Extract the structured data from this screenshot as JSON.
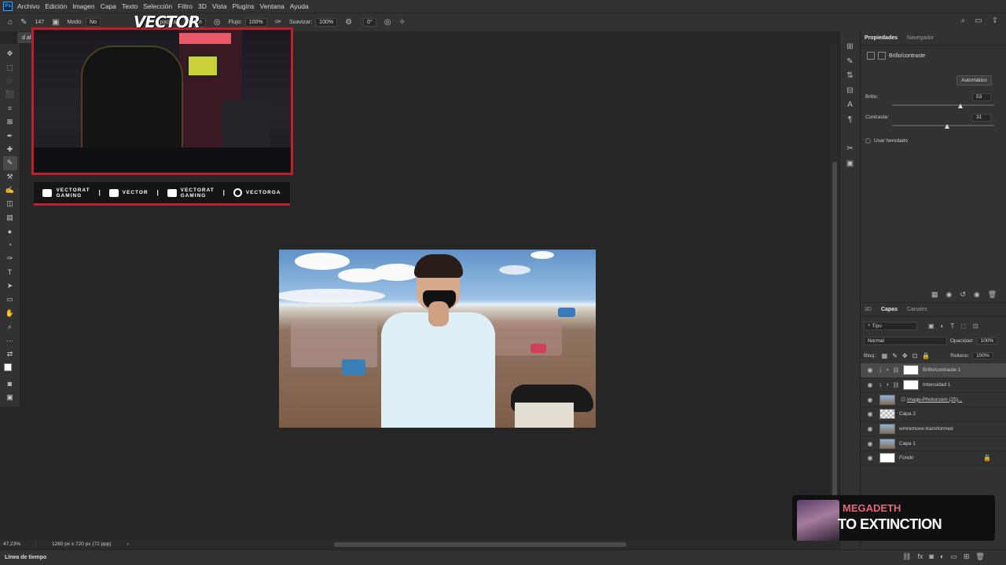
{
  "menubar": {
    "logo": "Ps",
    "items": [
      "Archivo",
      "Edición",
      "Imagen",
      "Capa",
      "Texto",
      "Selección",
      "Filtro",
      "3D",
      "Vista",
      "Plugins",
      "Ventana",
      "Ayuda"
    ]
  },
  "options": {
    "mode_label": "Modo:",
    "mode_value": "No",
    "opacity_label": "Opacidad:",
    "opacity_value": "100%",
    "flow_label": "Flujo:",
    "flow_value": "100%",
    "smooth_label": "Suavizar:",
    "smooth_value": "100%",
    "angle_value": "0°",
    "brush_size": "147"
  },
  "overlay_logo": "VECTOR",
  "doc_tab": "d al",
  "social": [
    {
      "icon": "youtube-icon",
      "text": "VECTORAT\nGAMING"
    },
    {
      "icon": "twitch-icon",
      "text": "VECTOR"
    },
    {
      "icon": "twitter-icon",
      "text": "VECTORAT\nGAMING"
    },
    {
      "icon": "instagram-icon",
      "text": "VECTORGA"
    }
  ],
  "properties": {
    "tab_properties": "Propiedades",
    "tab_navigator": "Navegador",
    "adjustment_name": "Brillo/contraste",
    "auto_button": "Automático",
    "brightness_label": "Brillo:",
    "brightness_value": "53",
    "contrast_label": "Contraste:",
    "contrast_value": "31",
    "legacy_label": "Usar heredado"
  },
  "layers_panel": {
    "tab_3d": "3D",
    "tab_layers": "Capas",
    "tab_channels": "Canales",
    "filter_label": "Tipo",
    "blend_mode": "Normal",
    "opacity_label": "Opacidad:",
    "opacity_value": "100%",
    "lock_label": "Bloq.:",
    "fill_label": "Relleno:",
    "fill_value": "100%",
    "layers": [
      {
        "name": "Brillo/contraste 1",
        "thumb": "white",
        "adjust": true,
        "selected": true
      },
      {
        "name": "Intensidad 1",
        "thumb": "white",
        "adjust": true,
        "selected": false
      },
      {
        "name": "image-Photoroom (25)...",
        "thumb": "img",
        "adjust": false,
        "selected": false
      },
      {
        "name": "Capa 2",
        "thumb": "checker",
        "adjust": false,
        "selected": false
      },
      {
        "name": "wmremove-transformed",
        "thumb": "img",
        "adjust": false,
        "selected": false
      },
      {
        "name": "Capa 1",
        "thumb": "img",
        "adjust": false,
        "selected": false
      },
      {
        "name": "Fondo",
        "thumb": "white",
        "adjust": false,
        "selected": false,
        "locked": true
      }
    ]
  },
  "status": {
    "zoom": "47,23%",
    "dimensions": "1280 px x 720 px (72 ppp)"
  },
  "timeline_label": "Línea de tiempo",
  "music": {
    "artist": "MEGADETH",
    "song": "TO EXTINCTION"
  }
}
